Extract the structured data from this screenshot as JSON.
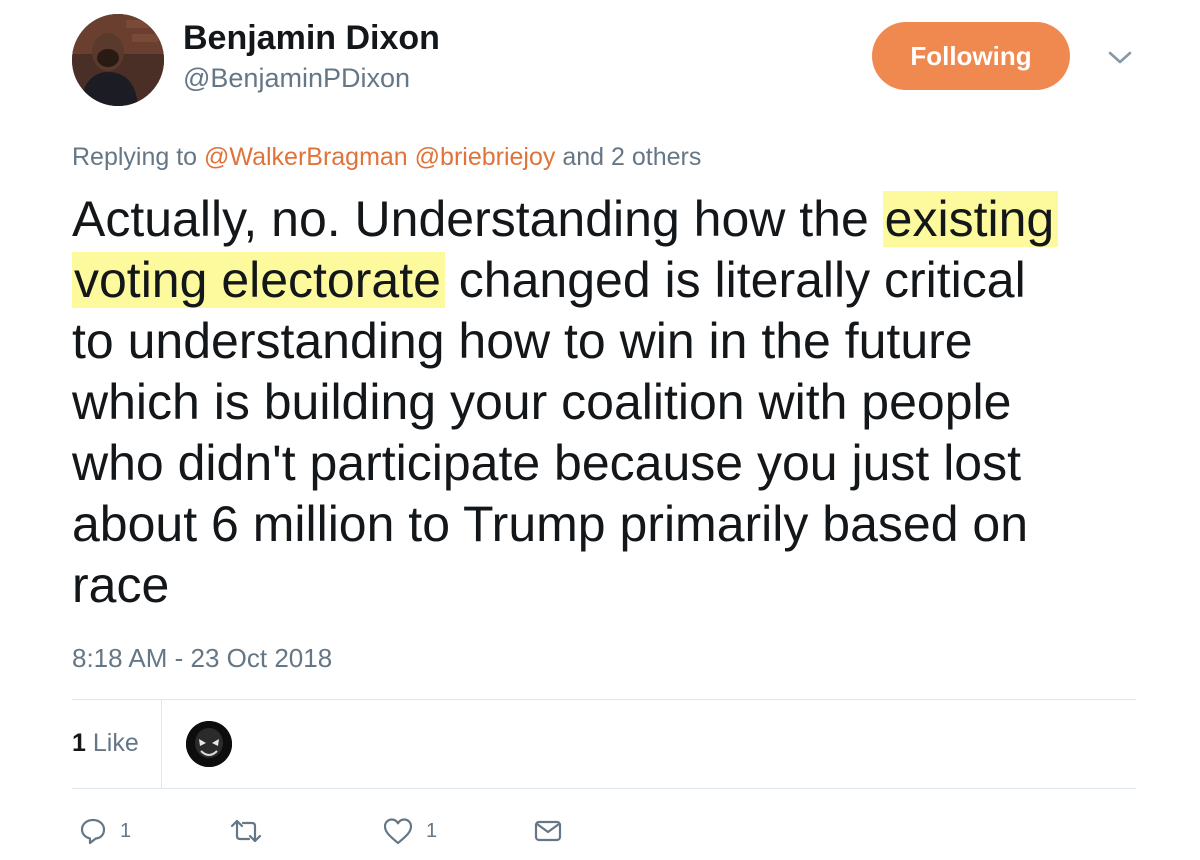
{
  "tweet": {
    "author": {
      "name": "Benjamin Dixon",
      "handle": "@BenjaminPDixon"
    },
    "follow_button_label": "Following",
    "reply": {
      "prefix": "Replying to",
      "mentions": [
        "@WalkerBragman",
        "@briebriejoy"
      ],
      "suffix": "and 2 others"
    },
    "text_lines": [
      {
        "before": "Actually, no. Understanding how the ",
        "highlight": "existing",
        "after": ""
      },
      {
        "before": "",
        "highlight": "voting electorate",
        "after": " changed is literally critical"
      },
      {
        "before": "to understanding how to win in the future",
        "highlight": "",
        "after": ""
      },
      {
        "before": "which is building your coalition with people",
        "highlight": "",
        "after": ""
      },
      {
        "before": "who didn't participate because you just lost",
        "highlight": "",
        "after": ""
      },
      {
        "before": "about 6 million to Trump primarily based on",
        "highlight": "",
        "after": ""
      },
      {
        "before": "race",
        "highlight": "",
        "after": ""
      }
    ],
    "timestamp": "8:18 AM - 23 Oct 2018",
    "likes": {
      "count": "1",
      "label": "Like"
    },
    "actions": {
      "reply_count": "1",
      "retweet_count": "",
      "like_count": "1"
    }
  },
  "icons": {
    "caret": "chevron-down-icon",
    "reply": "reply-icon",
    "retweet": "retweet-icon",
    "like": "heart-icon",
    "message": "envelope-icon"
  },
  "colors": {
    "accent": "#f0894f",
    "mention": "#e0733a",
    "highlight": "#fdfa9e",
    "secondary_text": "#657786",
    "primary_text": "#14171a"
  }
}
